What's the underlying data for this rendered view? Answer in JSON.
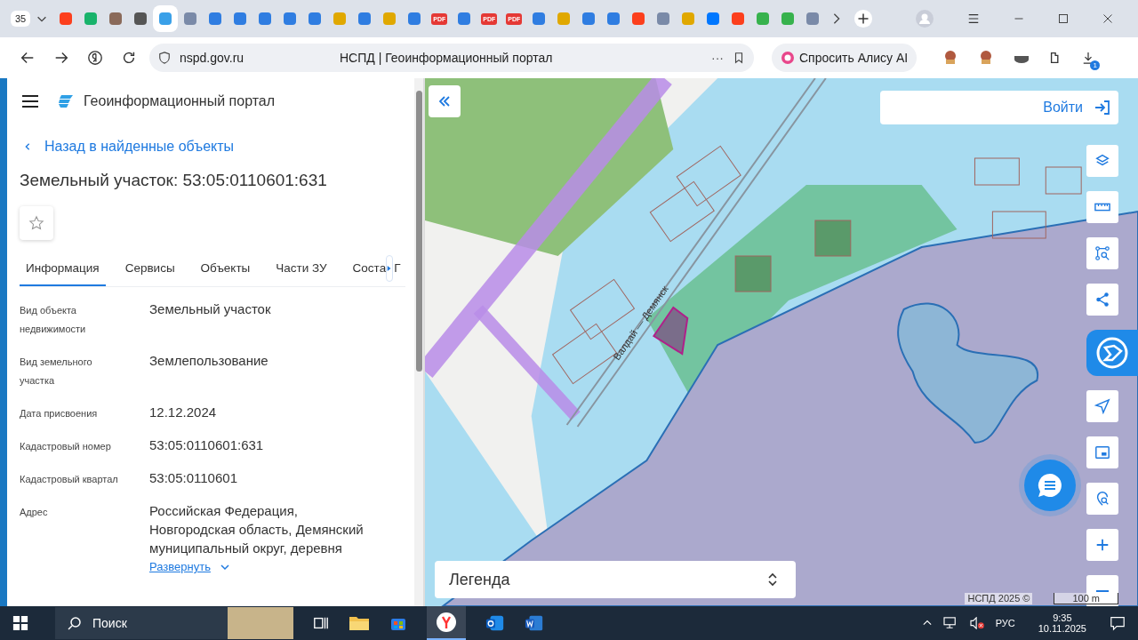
{
  "browser": {
    "tab_count": "35",
    "tabs": [
      {
        "kind": "favicon",
        "color": "#fc3f1d",
        "selected": false
      },
      {
        "kind": "favicon",
        "color": "#19b36b",
        "selected": false
      },
      {
        "kind": "favicon",
        "color": "#8a6a5a",
        "selected": false
      },
      {
        "kind": "favicon",
        "color": "#555555",
        "selected": false
      },
      {
        "kind": "favicon",
        "color": "#3aa0e8",
        "selected": true
      },
      {
        "kind": "favicon",
        "color": "#7a8aa8",
        "selected": false
      },
      {
        "kind": "favicon",
        "color": "#2f7de1",
        "selected": false
      },
      {
        "kind": "favicon",
        "color": "#2f7de1",
        "selected": false
      },
      {
        "kind": "favicon",
        "color": "#2f7de1",
        "selected": false
      },
      {
        "kind": "favicon",
        "color": "#2f7de1",
        "selected": false
      },
      {
        "kind": "favicon",
        "color": "#2f7de1",
        "selected": false
      },
      {
        "kind": "favicon",
        "color": "#e0a800",
        "selected": false
      },
      {
        "kind": "favicon",
        "color": "#2f7de1",
        "selected": false
      },
      {
        "kind": "favicon",
        "color": "#e0a800",
        "selected": false
      },
      {
        "kind": "favicon",
        "color": "#2f7de1",
        "selected": false
      },
      {
        "kind": "pdf",
        "label": "PDF",
        "color": "#e53935",
        "selected": false
      },
      {
        "kind": "favicon",
        "color": "#2f7de1",
        "selected": false
      },
      {
        "kind": "pdf",
        "label": "PDF",
        "color": "#e53935",
        "selected": false
      },
      {
        "kind": "pdf",
        "label": "PDF",
        "color": "#e53935",
        "selected": false
      },
      {
        "kind": "favicon",
        "color": "#2f7de1",
        "selected": false
      },
      {
        "kind": "favicon",
        "color": "#e0a800",
        "selected": false
      },
      {
        "kind": "favicon",
        "color": "#2f7de1",
        "selected": false
      },
      {
        "kind": "favicon",
        "color": "#2f7de1",
        "selected": false
      },
      {
        "kind": "favicon",
        "color": "#fc3f1d",
        "selected": false
      },
      {
        "kind": "favicon",
        "color": "#7a8aa8",
        "selected": false
      },
      {
        "kind": "favicon",
        "color": "#e0a800",
        "selected": false
      },
      {
        "kind": "favicon",
        "color": "#0077ff",
        "selected": false
      },
      {
        "kind": "favicon",
        "color": "#fc3f1d",
        "selected": false
      },
      {
        "kind": "favicon",
        "color": "#37b24d",
        "selected": false
      },
      {
        "kind": "favicon",
        "color": "#37b24d",
        "selected": false
      },
      {
        "kind": "favicon",
        "color": "#7a8aa8",
        "selected": false
      }
    ],
    "url": "nspd.gov.ru",
    "page_title": "НСПД | Геоинформационный портал",
    "more": "···",
    "alice_button": "Спросить Алису AI",
    "download_badge": "1"
  },
  "sidebar": {
    "portal_name": "Геоинформационный портал",
    "back_link": "Назад в найденные объекты",
    "title": "Земельный участок: 53:05:0110601:631",
    "tabs": [
      {
        "label": "Информация",
        "selected": true
      },
      {
        "label": "Сервисы",
        "selected": false
      },
      {
        "label": "Объекты",
        "selected": false
      },
      {
        "label": "Части ЗУ",
        "selected": false
      },
      {
        "label": "Соста",
        "selected": false
      }
    ],
    "tab_after_arrow": "Г",
    "properties": [
      {
        "label": "Вид объекта недвижимости",
        "value": "Земельный участок"
      },
      {
        "label": "Вид земельного участка",
        "value": "Землепользование"
      },
      {
        "label": "Дата присвоения",
        "value": "12.12.2024"
      },
      {
        "label": "Кадастровый номер",
        "value": "53:05:0110601:631"
      },
      {
        "label": "Кадастровый квартал",
        "value": "53:05:0110601"
      },
      {
        "label": "Адрес",
        "value": "Российская Федерация, Новгородская область, Демянский муниципальный округ, деревня",
        "expand_link": "Развернуть"
      }
    ]
  },
  "map": {
    "road_label": "Валдай — Демянск",
    "login_button": "Войти",
    "legend": "Легенда",
    "attribution": "НСПД 2025 ©",
    "scale": "100 m"
  },
  "taskbar": {
    "search_placeholder": "Поиск",
    "language": "РУС",
    "time": "9:35",
    "date": "10.11.2025"
  }
}
